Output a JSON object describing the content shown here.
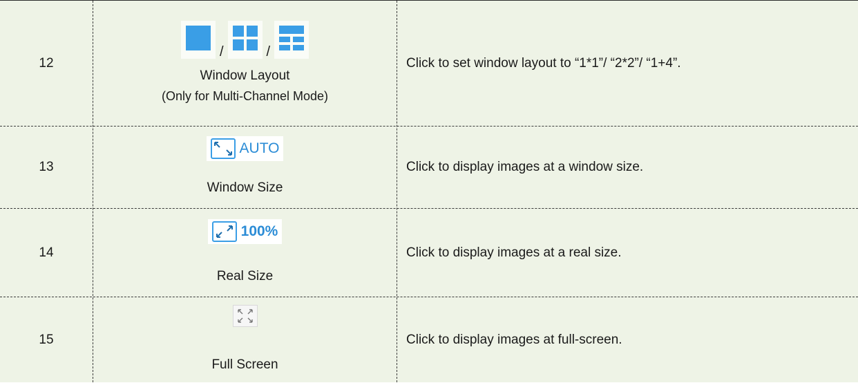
{
  "rows": [
    {
      "number": "12",
      "separator": "/",
      "name": "Window Layout",
      "note": "(Only for Multi-Channel Mode)",
      "description": "Click to set window layout to “1*1”/ “2*2”/ “1+4”.",
      "icons": [
        "layout-1x1-icon",
        "layout-2x2-icon",
        "layout-1plus4-icon"
      ]
    },
    {
      "number": "13",
      "icon_label": "AUTO",
      "name": "Window Size",
      "description": "Click to display images at a window size.",
      "icons": [
        "shrink-arrows-icon"
      ]
    },
    {
      "number": "14",
      "icon_label": "100%",
      "name": "Real Size",
      "description": "Click to display images at a real size.",
      "icons": [
        "expand-arrows-icon"
      ]
    },
    {
      "number": "15",
      "name": "Full Screen",
      "description": "Click to display images at full-screen.",
      "icons": [
        "fullscreen-icon"
      ]
    }
  ],
  "colors": {
    "background": "#eef3e6",
    "accent_blue": "#2b8cd6",
    "icon_blue": "#3a9ee6"
  }
}
